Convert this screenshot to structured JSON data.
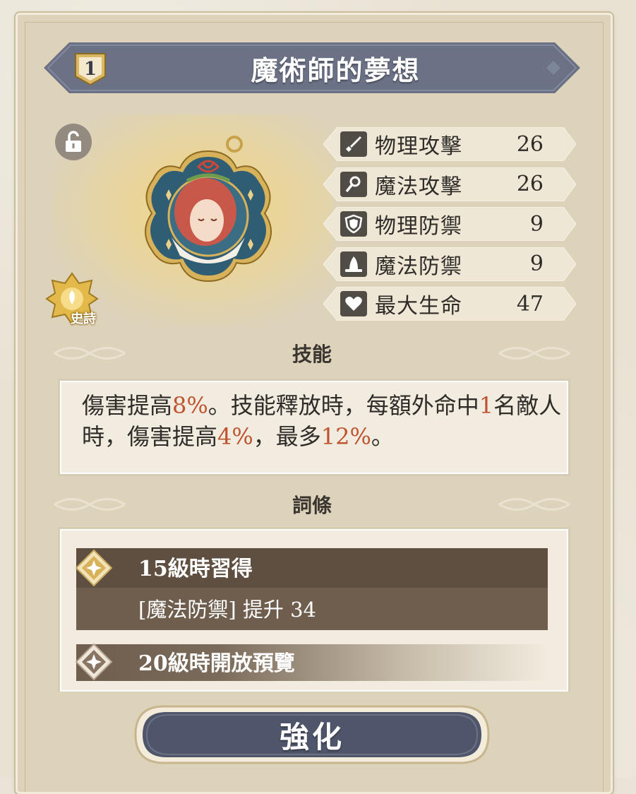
{
  "item": {
    "rank": "1",
    "name": "魔術師的夢想",
    "rarity": "史詩"
  },
  "stats": [
    {
      "label": "物理攻擊",
      "value": "26",
      "icon": "sword-icon"
    },
    {
      "label": "魔法攻擊",
      "value": "26",
      "icon": "staff-icon"
    },
    {
      "label": "物理防禦",
      "value": "9",
      "icon": "shield-icon"
    },
    {
      "label": "魔法防禦",
      "value": "9",
      "icon": "wizard-hat-icon"
    },
    {
      "label": "最大生命",
      "value": "47",
      "icon": "heart-icon"
    }
  ],
  "skill": {
    "header": "技能",
    "segments": {
      "s1": "傷害提高",
      "v1": "8%",
      "s2": "。技能釋放時，每額外命中",
      "v2": "1",
      "s3": "名敵人時，傷害提高",
      "v3": "4%",
      "s4": "，最多",
      "v4": "12%",
      "s5": "。"
    }
  },
  "affixes": {
    "header": "詞條",
    "items": [
      {
        "title": "15級時習得",
        "desc": "[魔法防禦] 提升 34"
      },
      {
        "title": "20級時開放預覽"
      }
    ]
  },
  "buttons": {
    "enhance": "強化"
  },
  "colors": {
    "highlight": "#c0532f",
    "ribbon": "#6b7286",
    "button": "#4f566b"
  }
}
